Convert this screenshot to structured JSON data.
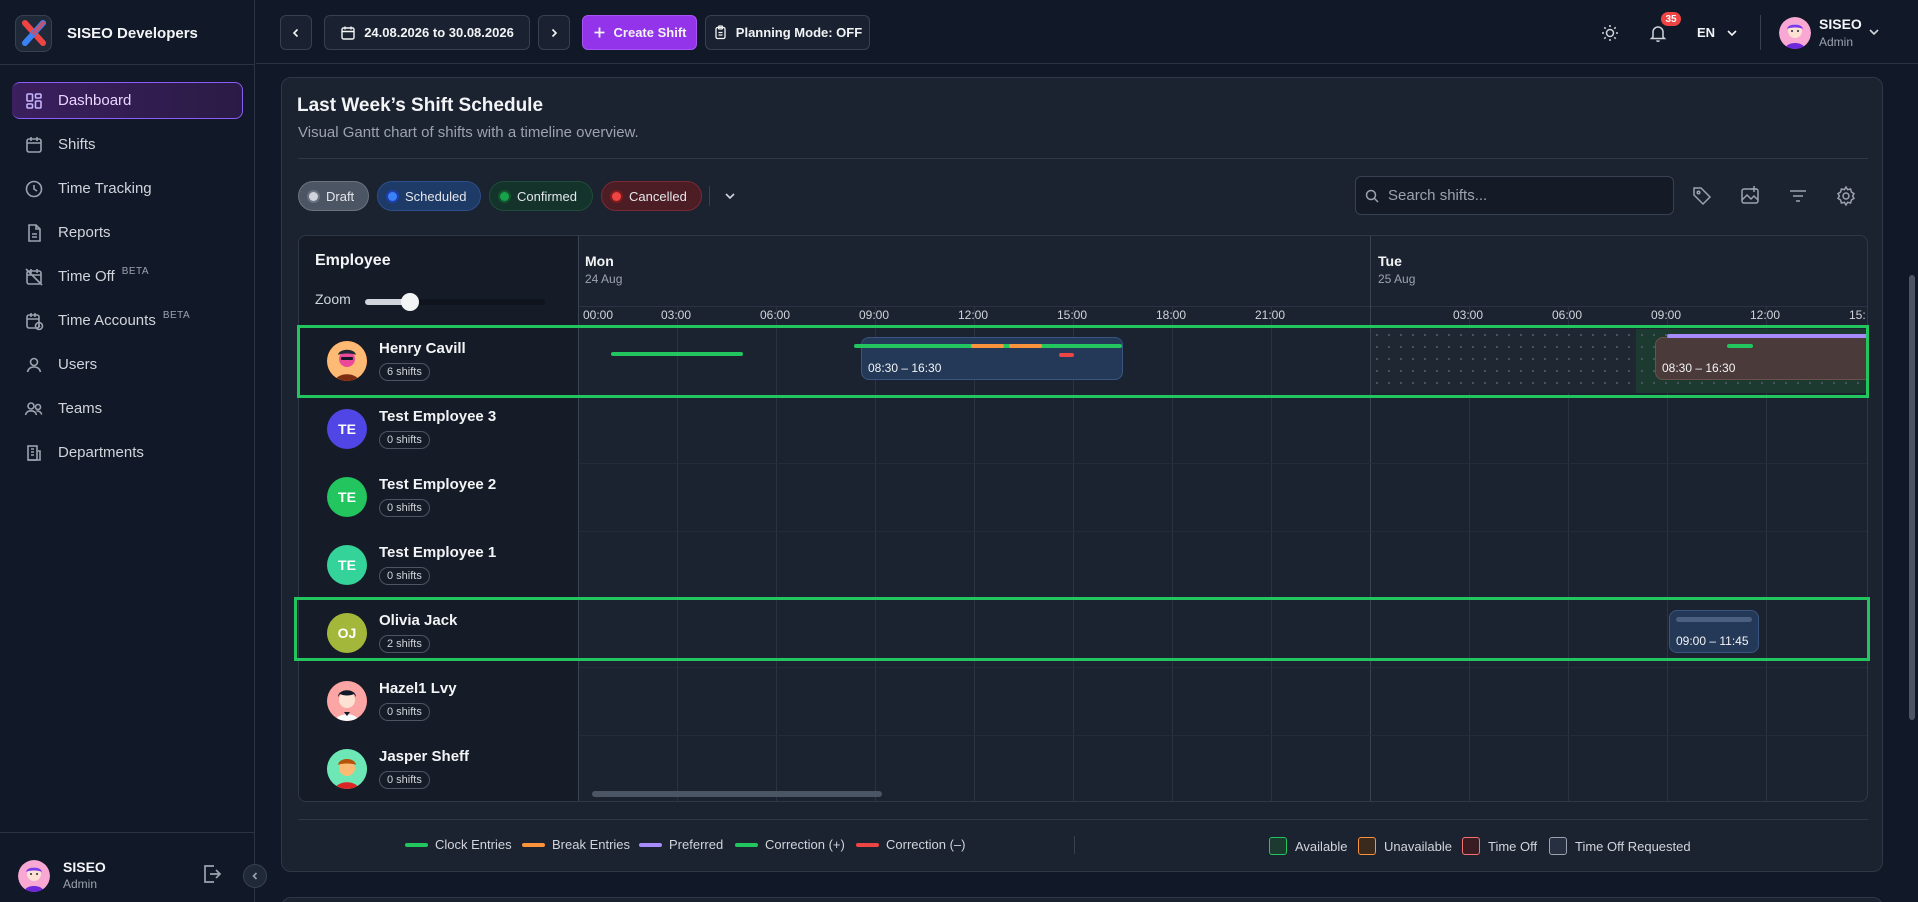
{
  "brand": {
    "name": "SISEO Developers"
  },
  "sidebar": {
    "items": [
      {
        "label": "Dashboard",
        "icon": "dashboard-icon",
        "active": true
      },
      {
        "label": "Shifts",
        "icon": "calendar-icon"
      },
      {
        "label": "Time Tracking",
        "icon": "clock-icon"
      },
      {
        "label": "Reports",
        "icon": "document-icon"
      },
      {
        "label": "Time Off",
        "icon": "time-off-icon",
        "badge": "BETA"
      },
      {
        "label": "Time Accounts",
        "icon": "time-accounts-icon",
        "badge": "BETA"
      },
      {
        "label": "Users",
        "icon": "user-icon"
      },
      {
        "label": "Teams",
        "icon": "teams-icon"
      },
      {
        "label": "Departments",
        "icon": "building-icon"
      }
    ],
    "user": {
      "name": "SISEO",
      "role": "Admin"
    }
  },
  "topbar": {
    "date_range": "24.08.2026 to 30.08.2026",
    "create_label": "Create Shift",
    "planning_label": "Planning Mode: OFF",
    "notif_count": "35",
    "lang": "EN",
    "user": {
      "name": "SISEO",
      "role": "Admin"
    }
  },
  "card": {
    "title": "Last Week’s Shift Schedule",
    "subtitle": "Visual Gantt chart of shifts with a timeline overview."
  },
  "filters": {
    "chips": [
      {
        "label": "Draft",
        "color": "#d1d5db"
      },
      {
        "label": "Scheduled",
        "color": "#3b82f6"
      },
      {
        "label": "Confirmed",
        "color": "#16a34a"
      },
      {
        "label": "Cancelled",
        "color": "#ef4444"
      }
    ],
    "search_placeholder": "Search shifts..."
  },
  "gantt": {
    "employee_header": "Employee",
    "zoom_label": "Zoom",
    "zoom_level": 0.25,
    "days": [
      {
        "name": "Mon",
        "date": "24 Aug"
      },
      {
        "name": "Tue",
        "date": "25 Aug"
      }
    ],
    "hours_mon": [
      "00:00",
      "03:00",
      "06:00",
      "09:00",
      "12:00",
      "15:00",
      "18:00",
      "21:00"
    ],
    "hours_tue": [
      "03:00",
      "06:00",
      "09:00",
      "12:00",
      "15:"
    ],
    "employees": [
      {
        "name": "Henry Cavill",
        "shifts": "6 shifts",
        "initials": "",
        "color": "#f97316",
        "highlight": true
      },
      {
        "name": "Test Employee 3",
        "shifts": "0 shifts",
        "initials": "TE",
        "color": "#4f46e5"
      },
      {
        "name": "Test Employee 2",
        "shifts": "0 shifts",
        "initials": "TE",
        "color": "#22c55e"
      },
      {
        "name": "Test Employee 1",
        "shifts": "0 shifts",
        "initials": "TE",
        "color": "#34d399"
      },
      {
        "name": "Olivia Jack",
        "shifts": "2 shifts",
        "initials": "OJ",
        "color": "#a3b83a",
        "highlight": true
      },
      {
        "name": "Hazel1 Lvy",
        "shifts": "0 shifts",
        "initials": "",
        "color": "#f87171"
      },
      {
        "name": "Jasper Sheff",
        "shifts": "0 shifts",
        "initials": "",
        "color": "#34d399"
      }
    ],
    "shift_labels": {
      "henry_mon": "08:30 – 16:30",
      "henry_tue": "08:30 – 16:30",
      "olivia_tue": "09:00 – 11:45"
    }
  },
  "legend": {
    "lines": [
      {
        "label": "Clock Entries",
        "color": "#22c55e"
      },
      {
        "label": "Break Entries",
        "color": "#fb923c"
      },
      {
        "label": "Preferred",
        "color": "#a78bfa"
      },
      {
        "label": "Correction (+)",
        "color": "#22c55e"
      },
      {
        "label": "Correction (–)",
        "color": "#ef4444"
      }
    ],
    "boxes": [
      {
        "label": "Available",
        "color": "#22c55e"
      },
      {
        "label": "Unavailable",
        "color": "#fb923c"
      },
      {
        "label": "Time Off",
        "color": "#f87171"
      },
      {
        "label": "Time Off Requested",
        "color": "#9ca3af"
      }
    ]
  }
}
